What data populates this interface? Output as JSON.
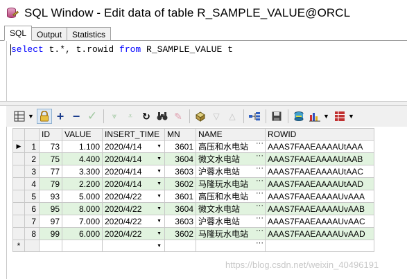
{
  "window": {
    "title": "SQL Window - Edit data of table R_SAMPLE_VALUE@ORCL"
  },
  "tabs": [
    "SQL",
    "Output",
    "Statistics"
  ],
  "editor": {
    "kw1": "select",
    "mid": " t.*, t.rowid ",
    "kw2": "from",
    "rest": " R_SAMPLE_VALUE t"
  },
  "toolbar": {
    "icons": [
      "grid-icon",
      "lock-icon",
      "add-record-icon",
      "delete-record-icon",
      "post-changes-icon",
      "fetch-next-icon",
      "fetch-last-icon",
      "refresh-icon",
      "find-icon",
      "clear-icon",
      "query-by-example-icon",
      "filter-down-icon",
      "filter-up-icon",
      "link-icon",
      "save-icon",
      "export-icon",
      "chart-icon",
      "import-icon"
    ]
  },
  "grid": {
    "columns": [
      "ID",
      "VALUE",
      "INSERT_TIME",
      "MN",
      "NAME",
      "ROWID"
    ],
    "rows": [
      {
        "rn": "1",
        "id": "73",
        "value": "1.100",
        "time": "2020/4/14",
        "mn": "3601",
        "name": "高压和水电站",
        "rowid": "AAAS7FAAEAAAAUtAAA"
      },
      {
        "rn": "2",
        "id": "75",
        "value": "4.400",
        "time": "2020/4/14",
        "mn": "3604",
        "name": "微文水电站",
        "rowid": "AAAS7FAAEAAAAUtAAB"
      },
      {
        "rn": "3",
        "id": "77",
        "value": "3.300",
        "time": "2020/4/14",
        "mn": "3603",
        "name": "沪蓉水电站",
        "rowid": "AAAS7FAAEAAAAUtAAC"
      },
      {
        "rn": "4",
        "id": "79",
        "value": "2.200",
        "time": "2020/4/14",
        "mn": "3602",
        "name": "马隆玩水电站",
        "rowid": "AAAS7FAAEAAAAUtAAD"
      },
      {
        "rn": "5",
        "id": "93",
        "value": "5.000",
        "time": "2020/4/22",
        "mn": "3601",
        "name": "高压和水电站",
        "rowid": "AAAS7FAAEAAAAUvAAA"
      },
      {
        "rn": "6",
        "id": "95",
        "value": "8.000",
        "time": "2020/4/22",
        "mn": "3604",
        "name": "微文水电站",
        "rowid": "AAAS7FAAEAAAAUvAAB"
      },
      {
        "rn": "7",
        "id": "97",
        "value": "7.000",
        "time": "2020/4/22",
        "mn": "3603",
        "name": "沪蓉水电站",
        "rowid": "AAAS7FAAEAAAAUvAAC"
      },
      {
        "rn": "8",
        "id": "99",
        "value": "6.000",
        "time": "2020/4/22",
        "mn": "3602",
        "name": "马隆玩水电站",
        "rowid": "AAAS7FAAEAAAAUvAAD"
      }
    ],
    "new_row_marker": "*",
    "current_row_marker": "▶",
    "ellipsis": "···"
  },
  "watermark": "https://blog.csdn.net/weixin_40496191"
}
